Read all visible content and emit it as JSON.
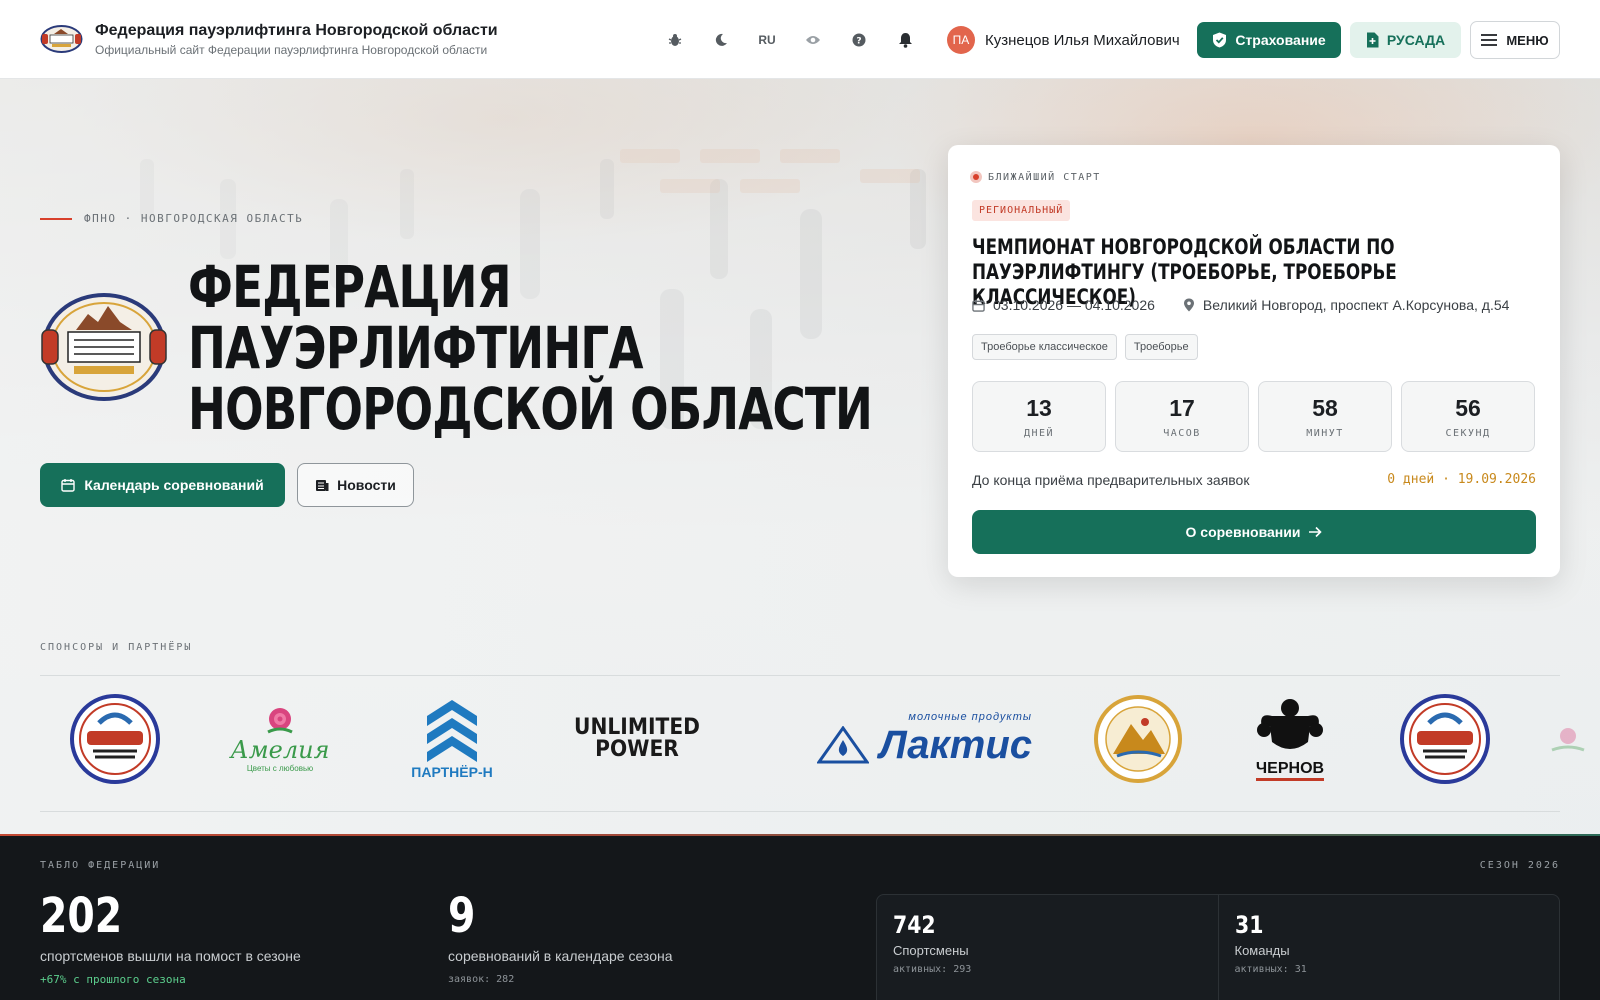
{
  "header": {
    "title": "Федерация пауэрлифтинга Новгородской области",
    "subtitle": "Официальный сайт Федерации пауэрлифтинга Новгородской области",
    "lang": "RU",
    "user_initials": "ПА",
    "user_name": "Кузнецов Илья Михайлович",
    "insurance_label": "Страхование",
    "rusada_label": "РУСАДА",
    "menu_label": "МЕНЮ"
  },
  "hero": {
    "eyebrow": "ФПНО · НОВГОРОДСКАЯ ОБЛАСТЬ",
    "title_line1": "ФЕДЕРАЦИЯ",
    "title_line2": "ПАУЭРЛИФТИНГА",
    "title_line3": "НОВГОРОДСКОЙ ОБЛАСТИ",
    "calendar_button": "Календарь соревнований",
    "news_button": "Новости"
  },
  "event": {
    "kicker": "БЛИЖАЙШИЙ СТАРТ",
    "badge": "РЕГИОНАЛЬНЫЙ",
    "title": "ЧЕМПИОНАТ НОВГОРОДСКОЙ ОБЛАСТИ ПО ПАУЭРЛИФТИНГУ (ТРОЕБОРЬЕ, ТРОЕБОРЬЕ КЛАССИЧЕСКОЕ)",
    "dates": "03.10.2026 — 04.10.2026",
    "location": "Великий Новгород, проспект А.Корсунова, д.54",
    "tags": [
      "Троеборье классическое",
      "Троеборье"
    ],
    "countdown": [
      {
        "value": "13",
        "label": "ДНЕЙ"
      },
      {
        "value": "17",
        "label": "ЧАСОВ"
      },
      {
        "value": "58",
        "label": "МИНУТ"
      },
      {
        "value": "56",
        "label": "СЕКУНД"
      }
    ],
    "deadline_label": "До конца приёма предварительных заявок",
    "deadline_value": "0 дней · 19.09.2026",
    "about_button": "О соревновании"
  },
  "sponsors": {
    "label": "СПОНСОРЫ И ПАРТНЁРЫ",
    "items": [
      {
        "name": "МАУДО \"СШОР №1\" Великий Новгород"
      },
      {
        "name": "Амелия",
        "tagline": "Цветы с любовью"
      },
      {
        "name": "ПАРТНЁР-Н"
      },
      {
        "name": "UNLIMITED POWER"
      },
      {
        "name": "Лактис",
        "tagline": "молочные продукты"
      },
      {
        "name": "Центр спортивной подготовки Новгородская область"
      },
      {
        "name": "ЧЕРНОВ"
      }
    ]
  },
  "board": {
    "label": "ТАБЛО ФЕДЕРАЦИИ",
    "season": "СЕЗОН 2026",
    "athletes_value": "202",
    "athletes_desc": "спортсменов вышли на помост в сезоне",
    "athletes_trend": "+67% с прошлого сезона",
    "comps_value": "9",
    "comps_desc": "соревнований в календаре сезона",
    "comps_sub": "заявок: 282",
    "mini": [
      {
        "value": "742",
        "name": "Спортсмены",
        "sub": "активных: 293"
      },
      {
        "value": "31",
        "name": "Команды",
        "sub": "активных: 31"
      }
    ]
  },
  "colors": {
    "primary": "#16705a",
    "accent_red": "#d8402b",
    "deadline": "#c8891c",
    "dark_bg": "#14171a"
  }
}
